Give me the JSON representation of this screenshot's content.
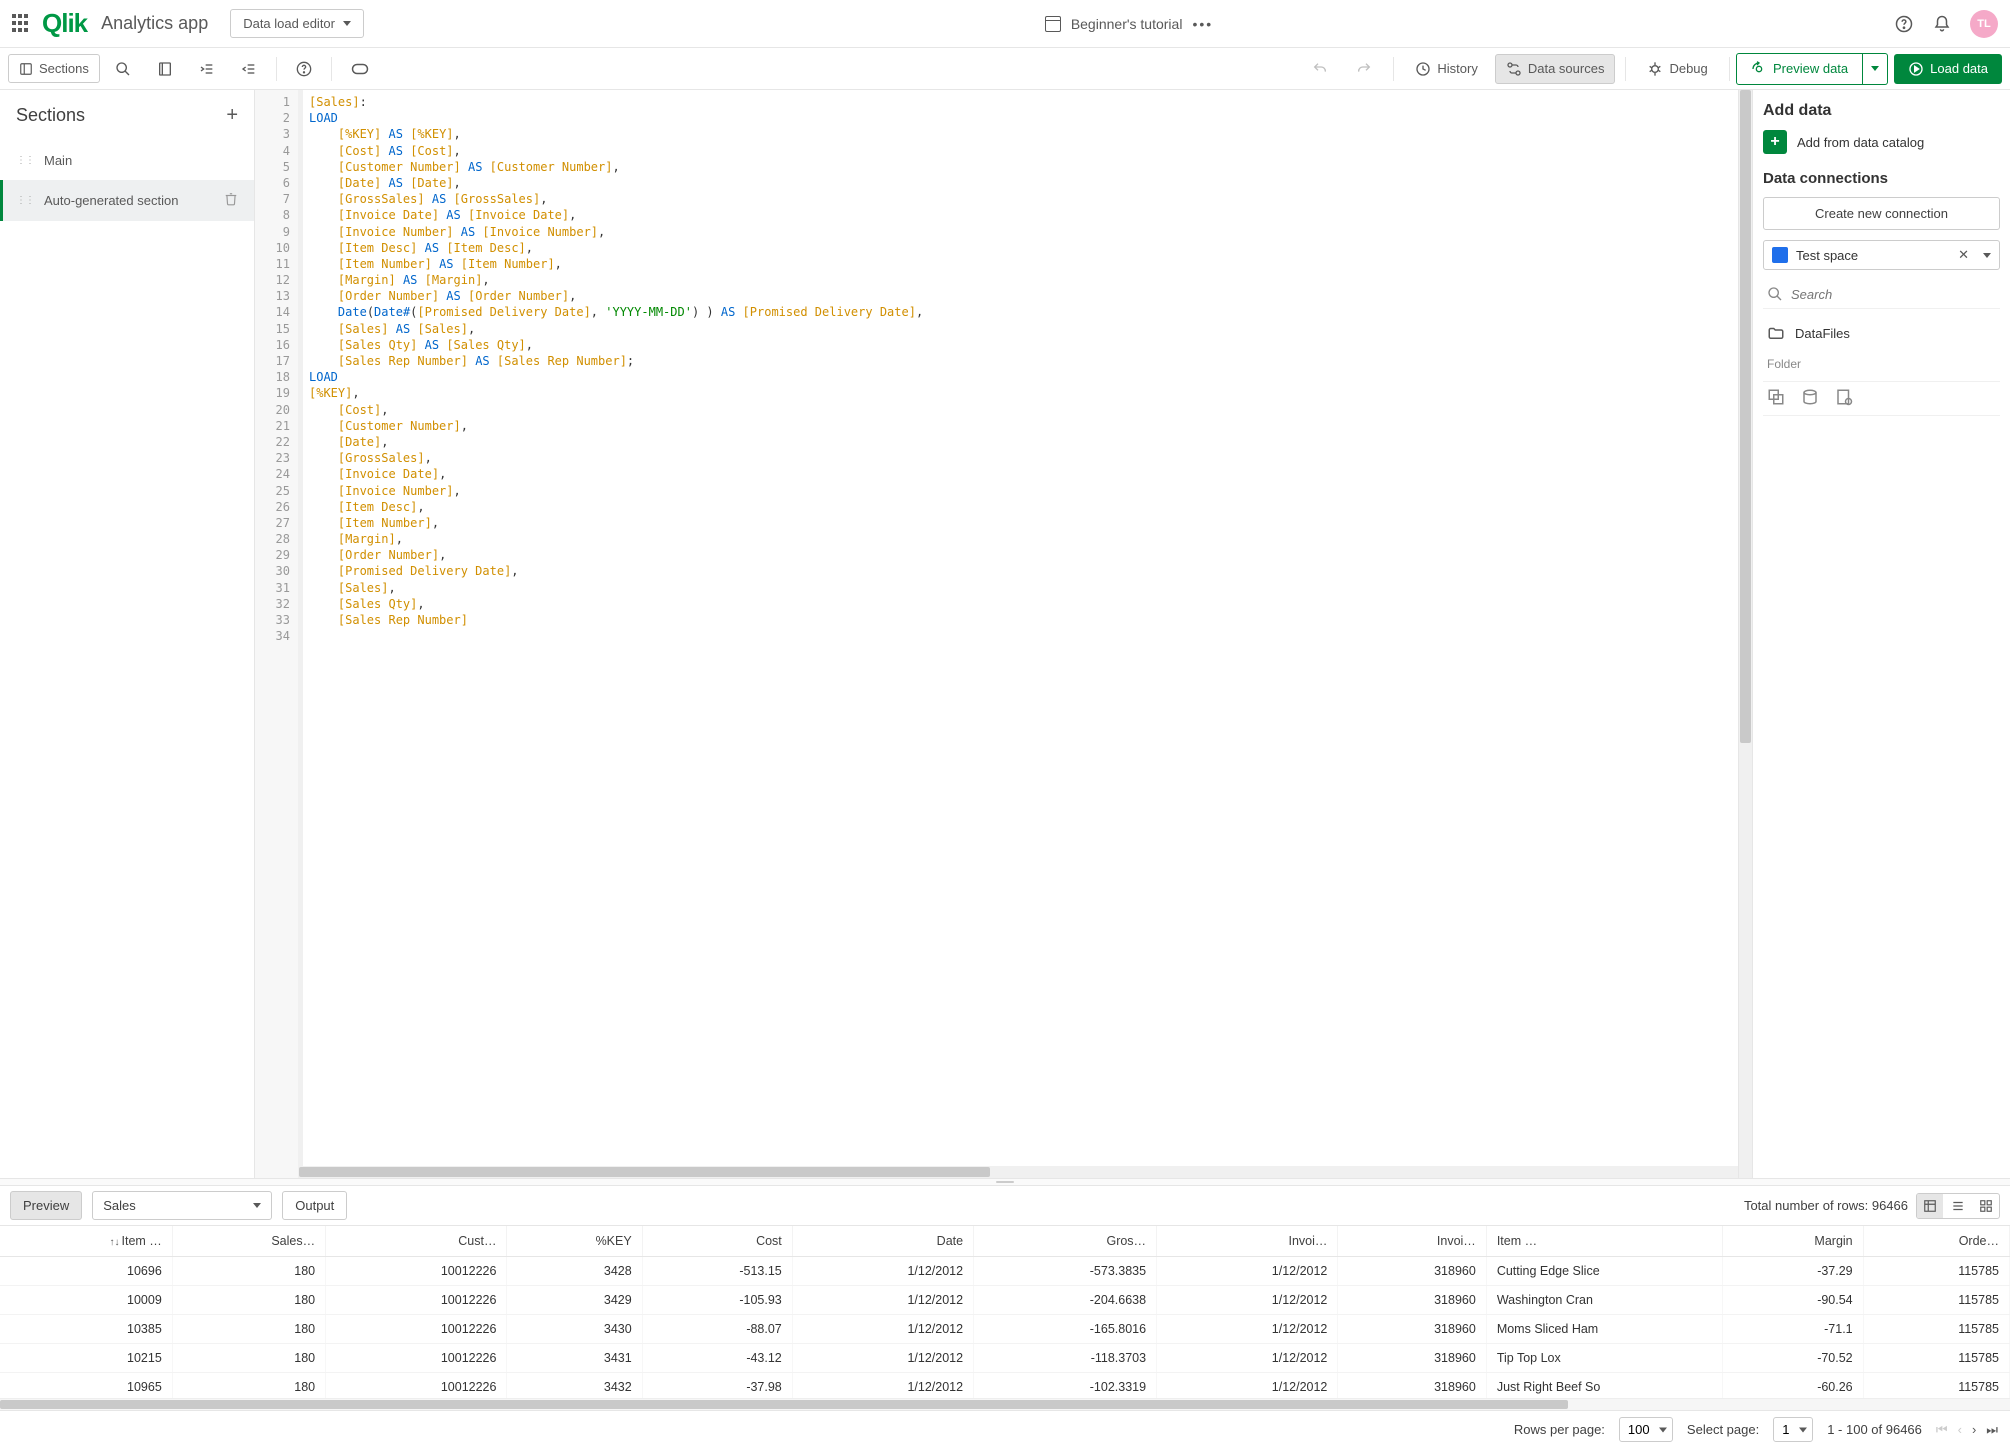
{
  "header": {
    "logo_text": "Qlik",
    "app_name": "Analytics app",
    "mode": "Data load editor",
    "tutorial": "Beginner's tutorial",
    "avatar": "TL"
  },
  "toolbar": {
    "sections": "Sections",
    "history": "History",
    "data_sources": "Data sources",
    "debug": "Debug",
    "preview_data": "Preview data",
    "load_data": "Load data"
  },
  "sections": {
    "title": "Sections",
    "items": [
      "Main",
      "Auto-generated section"
    ]
  },
  "right": {
    "add_data": "Add data",
    "add_catalog": "Add from data catalog",
    "data_connections": "Data connections",
    "create_connection": "Create new connection",
    "space": "Test space",
    "search_placeholder": "Search",
    "datafiles": "DataFiles",
    "folder": "Folder"
  },
  "code": {
    "lines": [
      [
        {
          "t": "[Sales]",
          "c": "br"
        },
        {
          "t": ":",
          "c": ""
        }
      ],
      [
        {
          "t": "LOAD",
          "c": "kw"
        }
      ],
      [
        {
          "t": "    ",
          "c": ""
        },
        {
          "t": "[%KEY]",
          "c": "br"
        },
        {
          "t": " ",
          "c": ""
        },
        {
          "t": "AS",
          "c": "kw"
        },
        {
          "t": " ",
          "c": ""
        },
        {
          "t": "[%KEY]",
          "c": "br"
        },
        {
          "t": ",",
          "c": ""
        }
      ],
      [
        {
          "t": "    ",
          "c": ""
        },
        {
          "t": "[Cost]",
          "c": "br"
        },
        {
          "t": " ",
          "c": ""
        },
        {
          "t": "AS",
          "c": "kw"
        },
        {
          "t": " ",
          "c": ""
        },
        {
          "t": "[Cost]",
          "c": "br"
        },
        {
          "t": ",",
          "c": ""
        }
      ],
      [
        {
          "t": "    ",
          "c": ""
        },
        {
          "t": "[Customer Number]",
          "c": "br"
        },
        {
          "t": " ",
          "c": ""
        },
        {
          "t": "AS",
          "c": "kw"
        },
        {
          "t": " ",
          "c": ""
        },
        {
          "t": "[Customer Number]",
          "c": "br"
        },
        {
          "t": ",",
          "c": ""
        }
      ],
      [
        {
          "t": "    ",
          "c": ""
        },
        {
          "t": "[Date]",
          "c": "br"
        },
        {
          "t": " ",
          "c": ""
        },
        {
          "t": "AS",
          "c": "kw"
        },
        {
          "t": " ",
          "c": ""
        },
        {
          "t": "[Date]",
          "c": "br"
        },
        {
          "t": ",",
          "c": ""
        }
      ],
      [
        {
          "t": "    ",
          "c": ""
        },
        {
          "t": "[GrossSales]",
          "c": "br"
        },
        {
          "t": " ",
          "c": ""
        },
        {
          "t": "AS",
          "c": "kw"
        },
        {
          "t": " ",
          "c": ""
        },
        {
          "t": "[GrossSales]",
          "c": "br"
        },
        {
          "t": ",",
          "c": ""
        }
      ],
      [
        {
          "t": "    ",
          "c": ""
        },
        {
          "t": "[Invoice Date]",
          "c": "br"
        },
        {
          "t": " ",
          "c": ""
        },
        {
          "t": "AS",
          "c": "kw"
        },
        {
          "t": " ",
          "c": ""
        },
        {
          "t": "[Invoice Date]",
          "c": "br"
        },
        {
          "t": ",",
          "c": ""
        }
      ],
      [
        {
          "t": "    ",
          "c": ""
        },
        {
          "t": "[Invoice Number]",
          "c": "br"
        },
        {
          "t": " ",
          "c": ""
        },
        {
          "t": "AS",
          "c": "kw"
        },
        {
          "t": " ",
          "c": ""
        },
        {
          "t": "[Invoice Number]",
          "c": "br"
        },
        {
          "t": ",",
          "c": ""
        }
      ],
      [
        {
          "t": "    ",
          "c": ""
        },
        {
          "t": "[Item Desc]",
          "c": "br"
        },
        {
          "t": " ",
          "c": ""
        },
        {
          "t": "AS",
          "c": "kw"
        },
        {
          "t": " ",
          "c": ""
        },
        {
          "t": "[Item Desc]",
          "c": "br"
        },
        {
          "t": ",",
          "c": ""
        }
      ],
      [
        {
          "t": "    ",
          "c": ""
        },
        {
          "t": "[Item Number]",
          "c": "br"
        },
        {
          "t": " ",
          "c": ""
        },
        {
          "t": "AS",
          "c": "kw"
        },
        {
          "t": " ",
          "c": ""
        },
        {
          "t": "[Item Number]",
          "c": "br"
        },
        {
          "t": ",",
          "c": ""
        }
      ],
      [
        {
          "t": "    ",
          "c": ""
        },
        {
          "t": "[Margin]",
          "c": "br"
        },
        {
          "t": " ",
          "c": ""
        },
        {
          "t": "AS",
          "c": "kw"
        },
        {
          "t": " ",
          "c": ""
        },
        {
          "t": "[Margin]",
          "c": "br"
        },
        {
          "t": ",",
          "c": ""
        }
      ],
      [
        {
          "t": "    ",
          "c": ""
        },
        {
          "t": "[Order Number]",
          "c": "br"
        },
        {
          "t": " ",
          "c": ""
        },
        {
          "t": "AS",
          "c": "kw"
        },
        {
          "t": " ",
          "c": ""
        },
        {
          "t": "[Order Number]",
          "c": "br"
        },
        {
          "t": ",",
          "c": ""
        }
      ],
      [
        {
          "t": "    ",
          "c": ""
        },
        {
          "t": "Date",
          "c": "fn"
        },
        {
          "t": "(",
          "c": ""
        },
        {
          "t": "Date#",
          "c": "fn"
        },
        {
          "t": "(",
          "c": ""
        },
        {
          "t": "[Promised Delivery Date]",
          "c": "br"
        },
        {
          "t": ", ",
          "c": ""
        },
        {
          "t": "'YYYY-MM-DD'",
          "c": "str"
        },
        {
          "t": ") ) ",
          "c": ""
        },
        {
          "t": "AS",
          "c": "kw"
        },
        {
          "t": " ",
          "c": ""
        },
        {
          "t": "[Promised Delivery Date]",
          "c": "br"
        },
        {
          "t": ",",
          "c": ""
        }
      ],
      [
        {
          "t": "    ",
          "c": ""
        },
        {
          "t": "[Sales]",
          "c": "br"
        },
        {
          "t": " ",
          "c": ""
        },
        {
          "t": "AS",
          "c": "kw"
        },
        {
          "t": " ",
          "c": ""
        },
        {
          "t": "[Sales]",
          "c": "br"
        },
        {
          "t": ",",
          "c": ""
        }
      ],
      [
        {
          "t": "    ",
          "c": ""
        },
        {
          "t": "[Sales Qty]",
          "c": "br"
        },
        {
          "t": " ",
          "c": ""
        },
        {
          "t": "AS",
          "c": "kw"
        },
        {
          "t": " ",
          "c": ""
        },
        {
          "t": "[Sales Qty]",
          "c": "br"
        },
        {
          "t": ",",
          "c": ""
        }
      ],
      [
        {
          "t": "    ",
          "c": ""
        },
        {
          "t": "[Sales Rep Number]",
          "c": "br"
        },
        {
          "t": " ",
          "c": ""
        },
        {
          "t": "AS",
          "c": "kw"
        },
        {
          "t": " ",
          "c": ""
        },
        {
          "t": "[Sales Rep Number]",
          "c": "br"
        },
        {
          "t": ";",
          "c": ""
        }
      ],
      [
        {
          "t": "LOAD",
          "c": "kw"
        }
      ],
      [
        {
          "t": "[%KEY]",
          "c": "br"
        },
        {
          "t": ",",
          "c": ""
        }
      ],
      [
        {
          "t": "    ",
          "c": ""
        },
        {
          "t": "[Cost]",
          "c": "br"
        },
        {
          "t": ",",
          "c": ""
        }
      ],
      [
        {
          "t": "    ",
          "c": ""
        },
        {
          "t": "[Customer Number]",
          "c": "br"
        },
        {
          "t": ",",
          "c": ""
        }
      ],
      [
        {
          "t": "    ",
          "c": ""
        },
        {
          "t": "[Date]",
          "c": "br"
        },
        {
          "t": ",",
          "c": ""
        }
      ],
      [
        {
          "t": "    ",
          "c": ""
        },
        {
          "t": "[GrossSales]",
          "c": "br"
        },
        {
          "t": ",",
          "c": ""
        }
      ],
      [
        {
          "t": "    ",
          "c": ""
        },
        {
          "t": "[Invoice Date]",
          "c": "br"
        },
        {
          "t": ",",
          "c": ""
        }
      ],
      [
        {
          "t": "    ",
          "c": ""
        },
        {
          "t": "[Invoice Number]",
          "c": "br"
        },
        {
          "t": ",",
          "c": ""
        }
      ],
      [
        {
          "t": "    ",
          "c": ""
        },
        {
          "t": "[Item Desc]",
          "c": "br"
        },
        {
          "t": ",",
          "c": ""
        }
      ],
      [
        {
          "t": "    ",
          "c": ""
        },
        {
          "t": "[Item Number]",
          "c": "br"
        },
        {
          "t": ",",
          "c": ""
        }
      ],
      [
        {
          "t": "    ",
          "c": ""
        },
        {
          "t": "[Margin]",
          "c": "br"
        },
        {
          "t": ",",
          "c": ""
        }
      ],
      [
        {
          "t": "    ",
          "c": ""
        },
        {
          "t": "[Order Number]",
          "c": "br"
        },
        {
          "t": ",",
          "c": ""
        }
      ],
      [
        {
          "t": "    ",
          "c": ""
        },
        {
          "t": "[Promised Delivery Date]",
          "c": "br"
        },
        {
          "t": ",",
          "c": ""
        }
      ],
      [
        {
          "t": "    ",
          "c": ""
        },
        {
          "t": "[Sales]",
          "c": "br"
        },
        {
          "t": ",",
          "c": ""
        }
      ],
      [
        {
          "t": "    ",
          "c": ""
        },
        {
          "t": "[Sales Qty]",
          "c": "br"
        },
        {
          "t": ",",
          "c": ""
        }
      ],
      [
        {
          "t": "    ",
          "c": ""
        },
        {
          "t": "[Sales Rep Number]",
          "c": "br"
        }
      ],
      [
        {
          "t": "",
          "c": ""
        }
      ]
    ]
  },
  "bottom": {
    "preview": "Preview",
    "output": "Output",
    "table_select": "Sales",
    "total_rows_label": "Total number of rows: 96466",
    "columns": [
      "Item …",
      "Sales…",
      "Cust…",
      "%KEY",
      "Cost",
      "Date",
      "Gros…",
      "Invoi…",
      "Invoi…",
      "Item …",
      "Margin",
      "Orde…"
    ],
    "rows": [
      [
        "10696",
        "180",
        "10012226",
        "3428",
        "-513.15",
        "1/12/2012",
        "-573.3835",
        "1/12/2012",
        "318960",
        "Cutting Edge Slice",
        "-37.29",
        "115785"
      ],
      [
        "10009",
        "180",
        "10012226",
        "3429",
        "-105.93",
        "1/12/2012",
        "-204.6638",
        "1/12/2012",
        "318960",
        "Washington Cran",
        "-90.54",
        "115785"
      ],
      [
        "10385",
        "180",
        "10012226",
        "3430",
        "-88.07",
        "1/12/2012",
        "-165.8016",
        "1/12/2012",
        "318960",
        "Moms Sliced Ham",
        "-71.1",
        "115785"
      ],
      [
        "10215",
        "180",
        "10012226",
        "3431",
        "-43.12",
        "1/12/2012",
        "-118.3703",
        "1/12/2012",
        "318960",
        "Tip Top Lox",
        "-70.52",
        "115785"
      ],
      [
        "10965",
        "180",
        "10012226",
        "3432",
        "-37.98",
        "1/12/2012",
        "-102.3319",
        "1/12/2012",
        "318960",
        "Just Right Beef So",
        "-60.26",
        "115785"
      ]
    ]
  },
  "pager": {
    "rows_per_page": "Rows per page:",
    "rows_value": "100",
    "select_page": "Select page:",
    "page_value": "1",
    "range": "1 - 100 of 96466"
  }
}
